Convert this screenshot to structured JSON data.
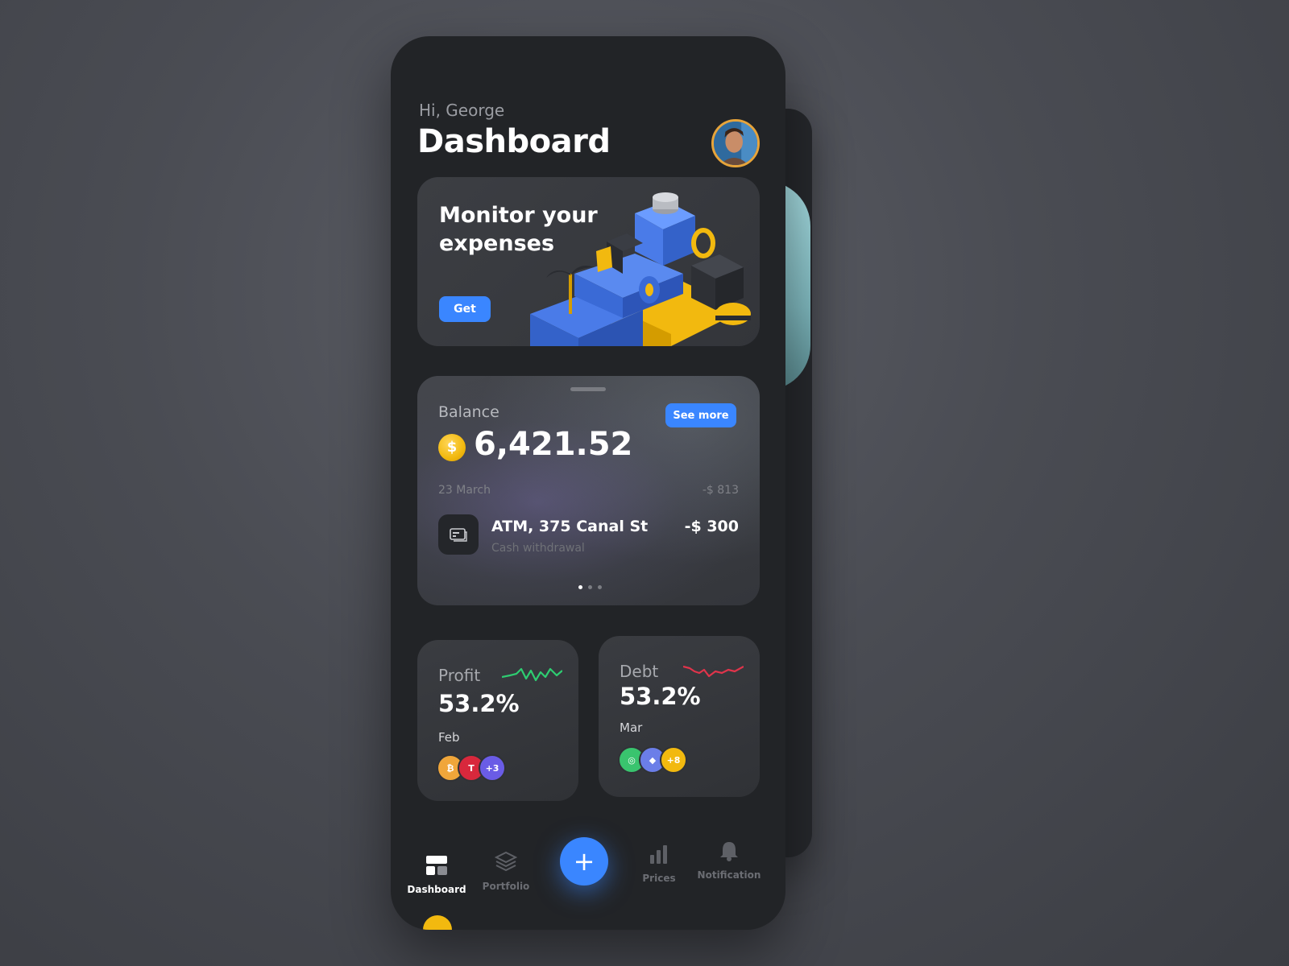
{
  "header": {
    "greeting": "Hi, George",
    "title": "Dashboard"
  },
  "promo": {
    "title": "Monitor your expenses",
    "button_label": "Get"
  },
  "balance": {
    "label": "Balance",
    "see_more_label": "See more",
    "currency_symbol": "$",
    "amount": "6,421.52",
    "date": "23 March",
    "day_total": "-$ 813",
    "transaction": {
      "name": "ATM, 375 Canal St",
      "subtitle": "Cash withdrawal",
      "amount": "-$ 300"
    }
  },
  "stats": {
    "profit": {
      "label": "Profit",
      "value": "53.2%",
      "month": "Feb",
      "more": "+3",
      "trend_color": "#2ecc71"
    },
    "debt": {
      "label": "Debt",
      "value": "53.2%",
      "month": "Mar",
      "more": "+8",
      "trend_color": "#e0344b"
    }
  },
  "nav": {
    "items": [
      {
        "label": "Dashboard",
        "icon": "dashboard-icon"
      },
      {
        "label": "Portfolio",
        "icon": "layers-icon"
      },
      {
        "label": "Prices",
        "icon": "bar-chart-icon"
      },
      {
        "label": "Notification",
        "icon": "bell-icon"
      }
    ],
    "fab_label": "+"
  },
  "colors": {
    "accent": "#3a86ff",
    "background": "#222427",
    "coin": "#f2b90f"
  }
}
